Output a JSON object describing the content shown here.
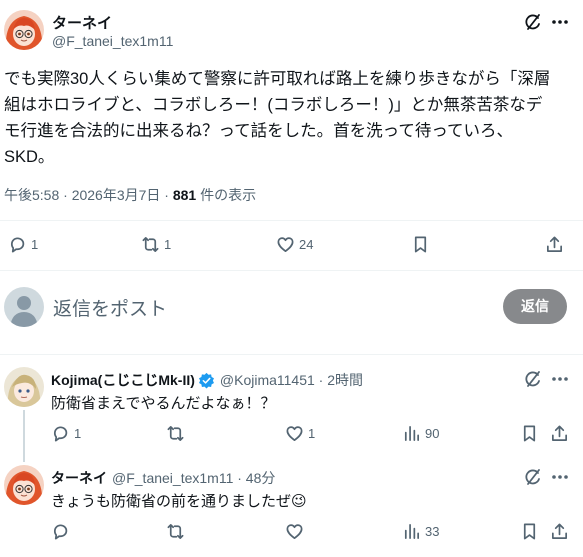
{
  "main_tweet": {
    "display_name": "ターネイ",
    "handle": "@F_tanei_tex1m11",
    "body_line1": "でも実際30人くらい集めて警察に許可取れば路上を練り歩きながら「深層",
    "body_line2": "組はホロライブと、コラボしろー！(コラボしろー！)」とか無茶苦茶なデ",
    "body_line3": "モ行進を合法的に出来るね？って話をした。首を洗って待っていろ、",
    "body_line4": "SKD。",
    "timestamp": "午後5:58 · 2026年3月7日 · ",
    "views": "881",
    "views_suffix": " 件の表示",
    "replies": "1",
    "reposts": "1",
    "likes": "24"
  },
  "reply_box": {
    "placeholder": "返信をポスト",
    "button_label": "返信"
  },
  "replies": [
    {
      "display_name": "Kojima(こじこじMk-II)",
      "handle_time": "@Kojima11451 · 2時間",
      "text": "防衛省まえでやるんだよなぁ！？",
      "replies": "1",
      "reposts": "",
      "likes": "1",
      "views": "90"
    },
    {
      "display_name": "ターネイ",
      "handle_time": "@F_tanei_tex1m11 · 48分",
      "text": "きょうも防衛省の前を通りましたぜ",
      "emoji": "😉",
      "replies": "",
      "reposts": "",
      "likes": "",
      "views": "33"
    }
  ],
  "colors": {
    "accent": "#1d9bf0",
    "muted": "#536471",
    "reply_button_bg": "#87898c",
    "thread_line": "#cfd9de"
  }
}
